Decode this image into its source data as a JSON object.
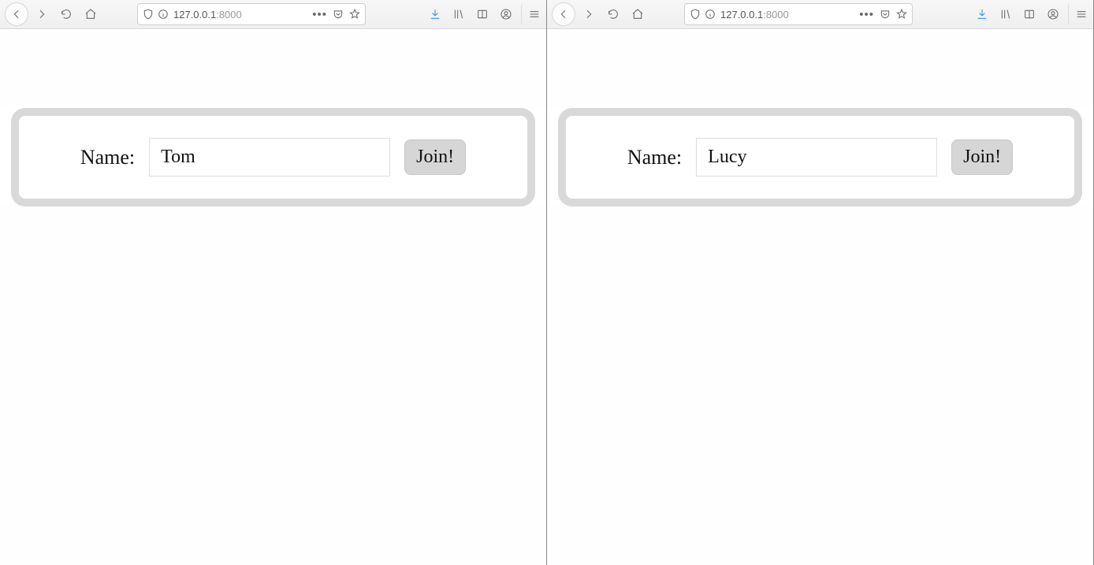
{
  "windows": [
    {
      "url_main": "127.0.0.1",
      "url_port": ":8000",
      "form": {
        "name_label": "Name:",
        "name_value": "Tom",
        "join_label": "Join!"
      }
    },
    {
      "url_main": "127.0.0.1",
      "url_port": ":8000",
      "form": {
        "name_label": "Name:",
        "name_value": "Lucy",
        "join_label": "Join!"
      }
    }
  ]
}
